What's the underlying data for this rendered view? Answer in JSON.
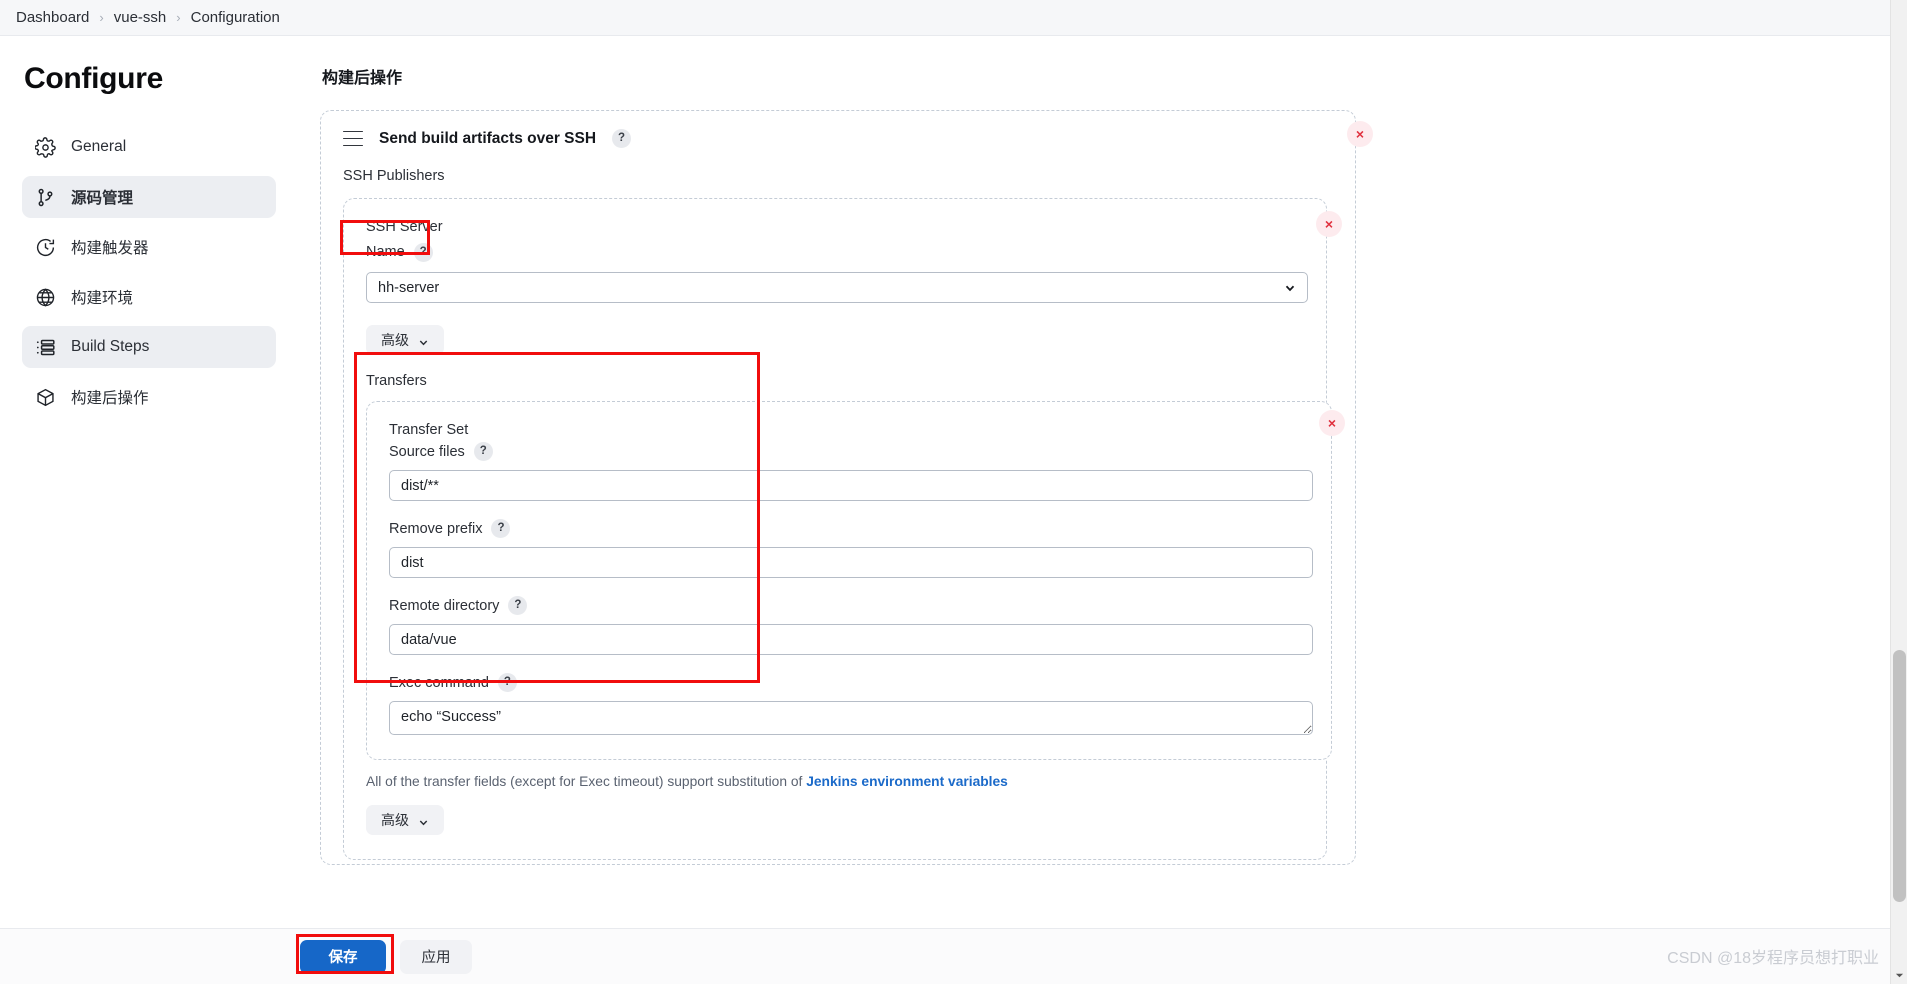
{
  "breadcrumb": {
    "items": [
      "Dashboard",
      "vue-ssh",
      "Configuration"
    ],
    "separator": "›"
  },
  "sidebar": {
    "title": "Configure",
    "items": [
      {
        "label": "General",
        "icon": "gear-icon",
        "state": "default"
      },
      {
        "label": "源码管理",
        "icon": "git-branch-icon",
        "state": "active-bold"
      },
      {
        "label": "构建触发器",
        "icon": "clock-icon",
        "state": "default"
      },
      {
        "label": "构建环境",
        "icon": "globe-icon",
        "state": "default"
      },
      {
        "label": "Build Steps",
        "icon": "list-icon",
        "state": "active"
      },
      {
        "label": "构建后操作",
        "icon": "package-icon",
        "state": "default"
      }
    ]
  },
  "main": {
    "section_title": "构建后操作",
    "publisher": {
      "title": "Send build artifacts over SSH",
      "help_glyph": "?",
      "drag_handle_icon": "drag-handle-icon",
      "close_glyph": "×",
      "publishers_label": "SSH Publishers",
      "server": {
        "group_label": "SSH Server",
        "name_label": "Name",
        "help_glyph": "?",
        "selected": "hh-server",
        "options": [
          "hh-server"
        ],
        "close_glyph": "×",
        "advanced_label": "高级",
        "caret_icon": "chevron-down-icon"
      },
      "transfers_label": "Transfers",
      "transfer_set": {
        "group_label": "Transfer Set",
        "close_glyph": "×",
        "fields": [
          {
            "label": "Source files",
            "help_glyph": "?",
            "value": "dist/**",
            "type": "text"
          },
          {
            "label": "Remove prefix",
            "help_glyph": "?",
            "value": "dist",
            "type": "text"
          },
          {
            "label": "Remote directory",
            "help_glyph": "?",
            "value": "data/vue",
            "type": "text"
          },
          {
            "label": "Exec command",
            "help_glyph": "?",
            "value": "echo “Success”",
            "type": "textarea"
          }
        ],
        "hint_prefix": "All of the transfer fields (except for Exec timeout) support substitution of ",
        "hint_link": "Jenkins environment variables",
        "advanced_label": "高级",
        "caret_icon": "chevron-down-icon"
      }
    }
  },
  "actions": {
    "save_label": "保存",
    "apply_label": "应用"
  },
  "watermark": "CSDN @18岁程序员想打职业",
  "colors": {
    "accent": "#1667c8",
    "annotation": "#f10d0d",
    "danger": "#e0303e",
    "link": "#1b6ac9"
  }
}
